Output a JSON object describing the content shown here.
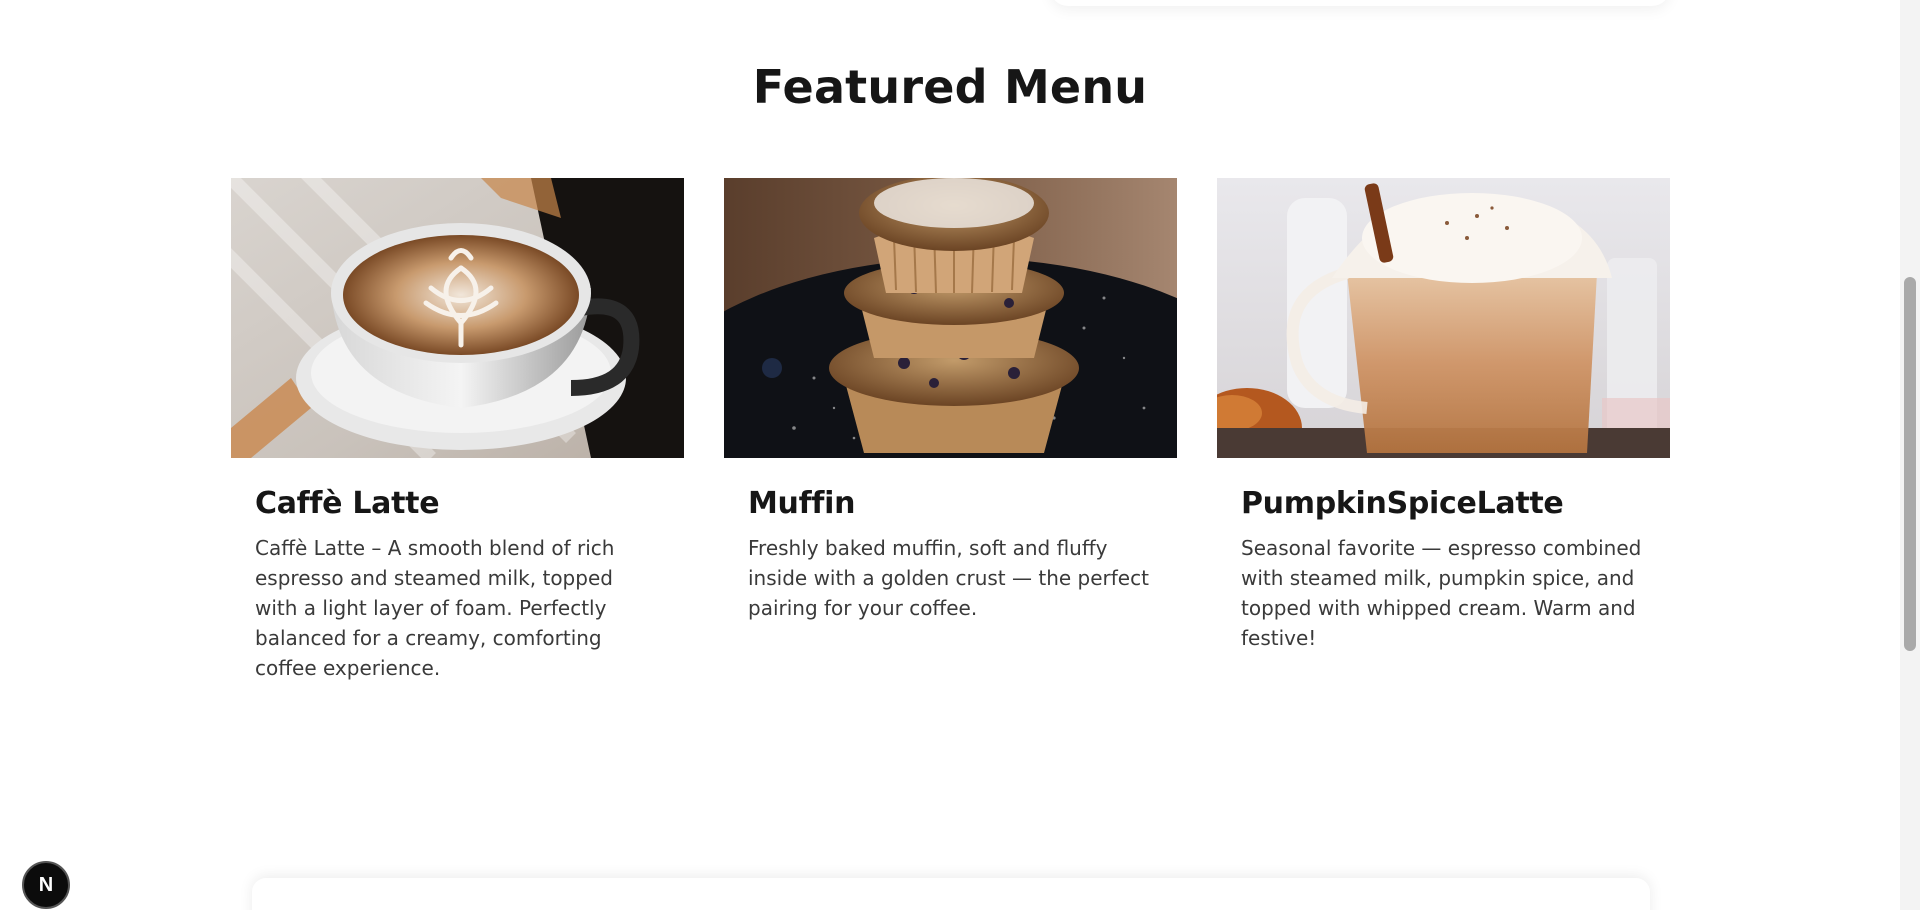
{
  "section": {
    "title": "Featured Menu"
  },
  "menu": {
    "items": [
      {
        "name": "Caffè Latte",
        "description": "Caffè Latte – A smooth blend of rich espresso and steamed milk, topped with a light layer of foam. Perfectly balanced for a creamy, comforting coffee experience."
      },
      {
        "name": "Muffin",
        "description": "Freshly baked muffin, soft and fluffy inside with a golden crust — the perfect pairing for your coffee."
      },
      {
        "name": "PumpkinSpiceLatte",
        "description": "Seasonal favorite — espresso combined with steamed milk, pumpkin spice, and topped with whipped cream. Warm and festive!"
      }
    ]
  },
  "dev_badge": {
    "label": "N"
  },
  "colors": {
    "heading": "#161616",
    "body_text": "#3a3a3a",
    "background": "#ffffff",
    "badge": "#0c0c0c"
  }
}
